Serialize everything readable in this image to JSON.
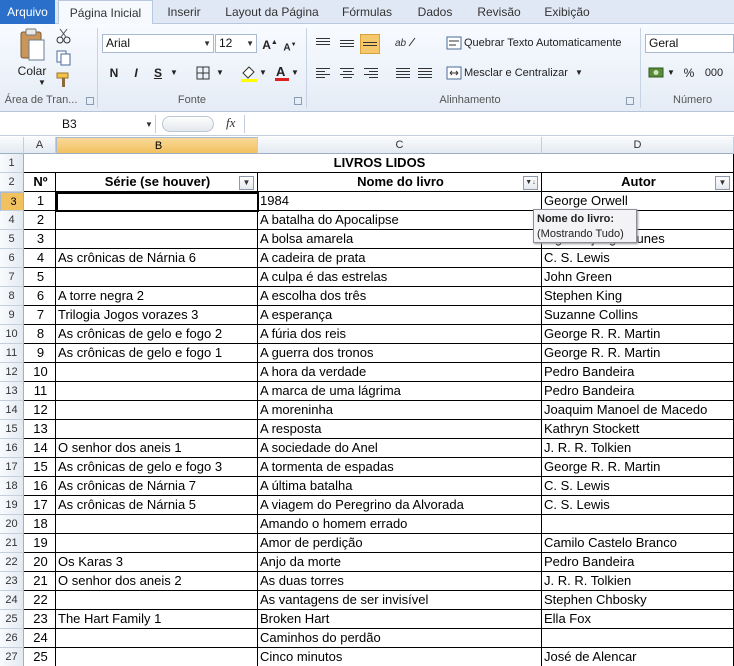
{
  "tabs": [
    "Arquivo",
    "Página Inicial",
    "Inserir",
    "Layout da Página",
    "Fórmulas",
    "Dados",
    "Revisão",
    "Exibição"
  ],
  "ribbon": {
    "clipboard": {
      "paste_label": "Colar",
      "group_label": "Área de Tran..."
    },
    "font": {
      "name": "Arial",
      "size": "12",
      "bold": "N",
      "italic": "I",
      "underline": "S",
      "group_label": "Fonte"
    },
    "alignment": {
      "wrap_label": "Quebrar Texto Automaticamente",
      "merge_label": "Mesclar e Centralizar",
      "group_label": "Alinhamento"
    },
    "number": {
      "format": "Geral",
      "percent": "%",
      "thousands": "000",
      "group_label": "Número"
    }
  },
  "formula_bar": {
    "name_box": "B3",
    "fx": "fx",
    "value": ""
  },
  "columns": [
    "A",
    "B",
    "C",
    "D"
  ],
  "sheet": {
    "title": "LIVROS LIDOS",
    "headers": [
      "Nº",
      "Série (se houver)",
      "Nome do livro",
      "Autor"
    ],
    "rows": [
      [
        "1",
        "",
        "1984",
        "George Orwell"
      ],
      [
        "2",
        "",
        "A batalha do Apocalipse",
        ""
      ],
      [
        "3",
        "",
        "A bolsa amarela",
        "Lígia Bojunga Nunes"
      ],
      [
        "4",
        "As crônicas de Nárnia 6",
        "A cadeira de prata",
        "C. S. Lewis"
      ],
      [
        "5",
        "",
        "A culpa é das estrelas",
        "John Green"
      ],
      [
        "6",
        "A torre negra 2",
        "A escolha dos três",
        "Stephen King"
      ],
      [
        "7",
        "Trilogia Jogos vorazes 3",
        "A esperança",
        "Suzanne Collins"
      ],
      [
        "8",
        "As crônicas de gelo e fogo 2",
        "A fúria dos reis",
        "George R. R. Martin"
      ],
      [
        "9",
        "As crônicas de gelo e fogo 1",
        "A guerra dos tronos",
        "George R. R. Martin"
      ],
      [
        "10",
        "",
        "A hora da verdade",
        "Pedro Bandeira"
      ],
      [
        "11",
        "",
        "A marca de uma lágrima",
        "Pedro Bandeira"
      ],
      [
        "12",
        "",
        "A moreninha",
        "Joaquim Manoel de Macedo"
      ],
      [
        "13",
        "",
        "A resposta",
        "Kathryn Stockett"
      ],
      [
        "14",
        "O senhor dos aneis 1",
        "A sociedade do Anel",
        "J. R. R. Tolkien"
      ],
      [
        "15",
        "As crônicas de gelo e fogo 3",
        "A tormenta de espadas",
        "George R. R. Martin"
      ],
      [
        "16",
        "As crônicas de Nárnia 7",
        "A última batalha",
        "C. S. Lewis"
      ],
      [
        "17",
        "As crônicas de Nárnia 5",
        "A viagem do Peregrino da Alvorada",
        "C. S. Lewis"
      ],
      [
        "18",
        "",
        "Amando o homem errado",
        ""
      ],
      [
        "19",
        "",
        "Amor de perdição",
        "Camilo Castelo Branco"
      ],
      [
        "20",
        "Os Karas 3",
        "Anjo da morte",
        "Pedro Bandeira"
      ],
      [
        "21",
        "O senhor dos aneis 2",
        "As duas torres",
        "J. R. R. Tolkien"
      ],
      [
        "22",
        "",
        "As vantagens de ser invisível",
        "Stephen Chbosky"
      ],
      [
        "23",
        "The Hart Family 1",
        "Broken Hart",
        "Ella Fox"
      ],
      [
        "24",
        "",
        "Caminhos do perdão",
        ""
      ],
      [
        "25",
        "",
        "Cinco minutos",
        "José de Alencar"
      ]
    ]
  },
  "tooltip": {
    "title": "Nome do livro:",
    "detail": "(Mostrando Tudo)"
  }
}
